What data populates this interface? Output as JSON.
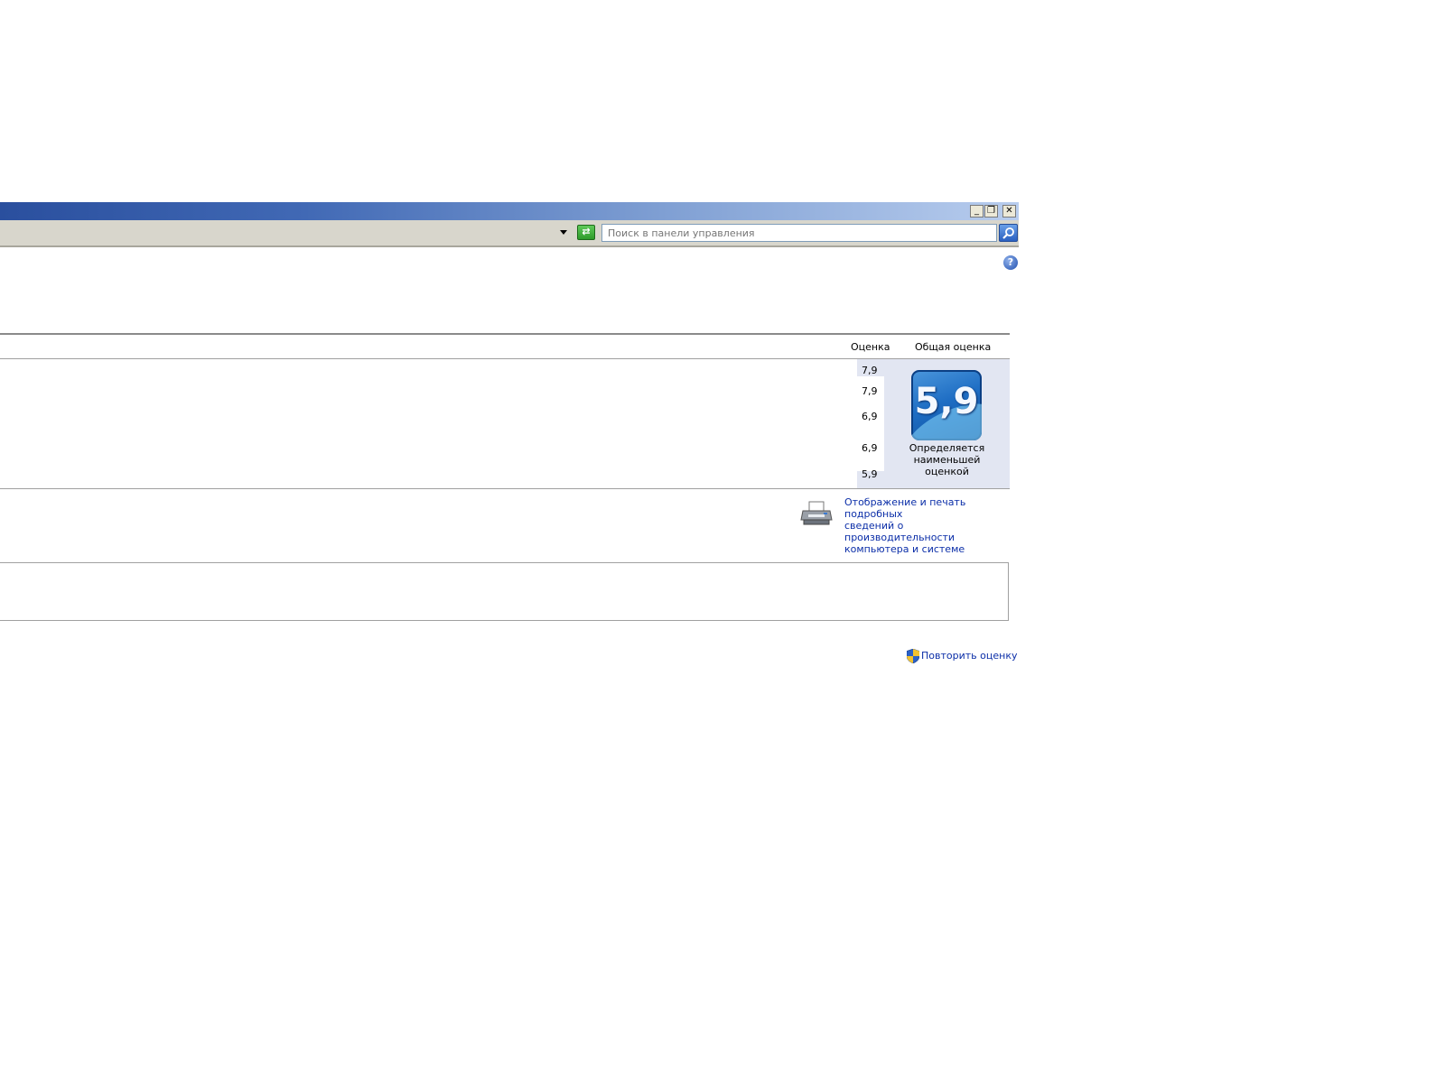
{
  "toolbar": {
    "search_placeholder": "Поиск в панели управления"
  },
  "table": {
    "header_score": "Оценка",
    "header_overall": "Общая оценка",
    "scores": [
      "7,9",
      "7,9",
      "6,9",
      "6,9",
      "5,9"
    ],
    "overall_value": "5,9",
    "overall_caption_1": "Определяется",
    "overall_caption_2": "наименьшей",
    "overall_caption_3": "оценкой"
  },
  "links": {
    "print_line_1": "Отображение и печать подробных",
    "print_line_2": "сведений о производительности",
    "print_line_3": "компьютера и системе",
    "rerun": "Повторить оценку"
  },
  "colors": {
    "link": "#0b2ea8",
    "badge": "#1f6ec4",
    "overall_panel_bg": "#e2e6f2"
  }
}
